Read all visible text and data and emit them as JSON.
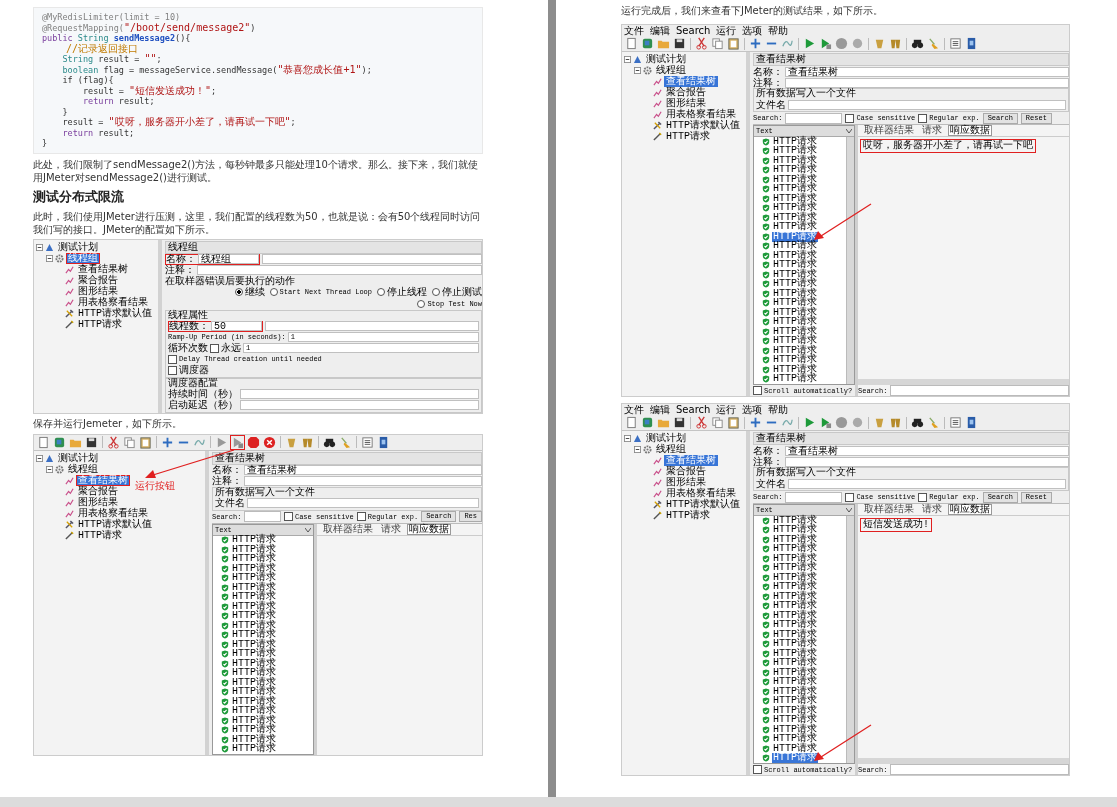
{
  "left_page": {
    "code_lines": [
      [
        {
          "text": "@MyRedisLimiter(limit = 10)",
          "kind": "annotation"
        }
      ],
      [
        {
          "text": "@RequestMapping(",
          "kind": "annotation"
        },
        {
          "text": "\"/boot/send/message2\"",
          "kind": "string"
        },
        {
          "text": ")",
          "kind": "plain"
        }
      ],
      [
        {
          "text": "public ",
          "kind": "keyword"
        },
        {
          "text": "String ",
          "kind": "type"
        },
        {
          "text": "sendMessage2",
          "kind": "method"
        },
        {
          "text": "(){",
          "kind": "plain"
        }
      ],
      [
        {
          "text": "    //记录返回接口",
          "kind": "comment"
        }
      ],
      [
        {
          "text": "    String",
          "kind": "type"
        },
        {
          "text": " result = ",
          "kind": "plain"
        },
        {
          "text": "\"\"",
          "kind": "string"
        },
        {
          "text": ";",
          "kind": "plain"
        }
      ],
      [
        {
          "text": "    boolean",
          "kind": "type"
        },
        {
          "text": " flag = messageService.sendMessage(",
          "kind": "plain"
        },
        {
          "text": "\"恭喜您成长值+1\"",
          "kind": "string"
        },
        {
          "text": ");",
          "kind": "plain"
        }
      ],
      [
        {
          "text": "    if (flag){",
          "kind": "plain"
        }
      ],
      [
        {
          "text": "        result = ",
          "kind": "plain"
        },
        {
          "text": "\"短信发送成功！\"",
          "kind": "string"
        },
        {
          "text": ";",
          "kind": "plain"
        }
      ],
      [
        {
          "text": "        return",
          "kind": "keyword"
        },
        {
          "text": " result;",
          "kind": "plain"
        }
      ],
      [
        {
          "text": "    }",
          "kind": "plain"
        }
      ],
      [
        {
          "text": "    result = ",
          "kind": "plain"
        },
        {
          "text": "\"哎呀，服务器开小差了，请再试一下吧\"",
          "kind": "string"
        },
        {
          "text": ";",
          "kind": "plain"
        }
      ],
      [
        {
          "text": "    return",
          "kind": "keyword"
        },
        {
          "text": " result;",
          "kind": "plain"
        }
      ],
      [
        {
          "text": "}",
          "kind": "plain"
        }
      ]
    ],
    "intro_text": "此处，我们限制了sendMessage2()方法，每秒钟最多只能处理10个请求。那么。接下来，我们就使用JMeter对sendMessage2()进行测试。",
    "heading": "测试分布式限流",
    "setup_text": "此时，我们使用JMeter进行压测，这里，我们配置的线程数为50，也就是说：会有50个线程同时访问我们写的接口。JMeter的配置如下所示。",
    "thread_group_screenshot": {
      "tree": [
        {
          "label": "测试计划",
          "kind": "plan",
          "selected": false,
          "marked": false,
          "children": [
            {
              "label": "线程组",
              "kind": "group",
              "selected": true,
              "marked": true,
              "children": [
                {
                  "label": "查看结果树",
                  "kind": "listener",
                  "selected": false,
                  "marked": false
                },
                {
                  "label": "聚合报告",
                  "kind": "listener",
                  "selected": false,
                  "marked": false
                },
                {
                  "label": "图形结果",
                  "kind": "listener",
                  "selected": false,
                  "marked": false
                },
                {
                  "label": "用表格察看结果",
                  "kind": "listener",
                  "selected": false,
                  "marked": false
                },
                {
                  "label": "HTTP请求默认值",
                  "kind": "config",
                  "selected": false,
                  "marked": false
                },
                {
                  "label": "HTTP请求",
                  "kind": "sampler",
                  "selected": false,
                  "marked": false
                }
              ]
            }
          ]
        }
      ],
      "panel": {
        "title": "线程组",
        "name_label": "名称：",
        "name": "线程组",
        "name_marked": true,
        "comment_label": "注释：",
        "error_action_label": "在取样器错误后要执行的动作",
        "error_actions": [
          {
            "label": "继续",
            "selected": true
          },
          {
            "label": "Start Next Thread Loop",
            "selected": false
          },
          {
            "label": "停止线程",
            "selected": false
          },
          {
            "label": "停止测试",
            "selected": false
          },
          {
            "label": "Stop Test Now",
            "selected": false
          }
        ],
        "properties_heading": "线程属性",
        "thread_count_label": "线程数：",
        "thread_count": "50",
        "thread_count_marked": true,
        "ramp_up_label": "Ramp-Up Period (in seconds):",
        "ramp_up": "1",
        "loop_label": "循环次数",
        "forever": {
          "label": "永远",
          "checked": false
        },
        "loops": "1",
        "delay_check": {
          "label": "Delay Thread creation until needed",
          "checked": false
        },
        "scheduler_check": {
          "label": "调度器",
          "checked": false
        },
        "scheduler_heading": "调度器配置",
        "duration_label": "持续时间（秒）",
        "startup_delay_label": "启动延迟（秒）"
      }
    },
    "run_caption": "保存并运行Jemeter，如下所示。",
    "run_screenshot": {
      "toolbar": {
        "running": true,
        "run_button_marked": true,
        "run_note": "运行按钮"
      },
      "tree": [
        {
          "label": "测试计划",
          "kind": "plan",
          "selected": false,
          "marked": false,
          "children": [
            {
              "label": "线程组",
              "kind": "group",
              "selected": false,
              "marked": false,
              "children": [
                {
                  "label": "查看结果树",
                  "kind": "listener",
                  "selected": true,
                  "marked": true
                },
                {
                  "label": "聚合报告",
                  "kind": "listener",
                  "selected": false,
                  "marked": false
                },
                {
                  "label": "图形结果",
                  "kind": "listener",
                  "selected": false,
                  "marked": false
                },
                {
                  "label": "用表格察看结果",
                  "kind": "listener",
                  "selected": false,
                  "marked": false
                },
                {
                  "label": "HTTP请求默认值",
                  "kind": "config",
                  "selected": false,
                  "marked": false
                },
                {
                  "label": "HTTP请求",
                  "kind": "sampler",
                  "selected": false,
                  "marked": false
                }
              ]
            }
          ]
        }
      ],
      "results": {
        "title": "查看结果树",
        "name_label": "名称：",
        "name": "查看结果树",
        "comment_label": "注释：",
        "file_heading": "所有数据写入一个文件",
        "file_label": "文件名",
        "search_label": "Search:",
        "checks": [
          {
            "label": "Case sensitive",
            "checked": false
          },
          {
            "label": "Regular exp.",
            "checked": false
          }
        ],
        "buttons": [
          "Search",
          "Res"
        ],
        "list_header": "Text",
        "rows": [
          {
            "label": "HTTP请求",
            "selected": false,
            "marked": false
          },
          {
            "label": "HTTP请求",
            "selected": false,
            "marked": false
          },
          {
            "label": "HTTP请求",
            "selected": false,
            "marked": false
          },
          {
            "label": "HTTP请求",
            "selected": false,
            "marked": false
          },
          {
            "label": "HTTP请求",
            "selected": false,
            "marked": false
          },
          {
            "label": "HTTP请求",
            "selected": false,
            "marked": false
          },
          {
            "label": "HTTP请求",
            "selected": false,
            "marked": false
          },
          {
            "label": "HTTP请求",
            "selected": false,
            "marked": false
          },
          {
            "label": "HTTP请求",
            "selected": false,
            "marked": false
          },
          {
            "label": "HTTP请求",
            "selected": false,
            "marked": false
          },
          {
            "label": "HTTP请求",
            "selected": false,
            "marked": false
          },
          {
            "label": "HTTP请求",
            "selected": false,
            "marked": false
          },
          {
            "label": "HTTP请求",
            "selected": false,
            "marked": false
          },
          {
            "label": "HTTP请求",
            "selected": false,
            "marked": false
          },
          {
            "label": "HTTP请求",
            "selected": false,
            "marked": false
          },
          {
            "label": "HTTP请求",
            "selected": false,
            "marked": false
          },
          {
            "label": "HTTP请求",
            "selected": false,
            "marked": false
          },
          {
            "label": "HTTP请求",
            "selected": false,
            "marked": false
          },
          {
            "label": "HTTP请求",
            "selected": false,
            "marked": false
          },
          {
            "label": "HTTP请求",
            "selected": false,
            "marked": false
          },
          {
            "label": "HTTP请求",
            "selected": false,
            "marked": false
          },
          {
            "label": "HTTP请求",
            "selected": false,
            "marked": false
          },
          {
            "label": "HTTP请求",
            "selected": false,
            "marked": false
          }
        ],
        "tabs": [
          {
            "label": "取样器结果",
            "selected": false
          },
          {
            "label": "请求",
            "selected": false
          },
          {
            "label": "响应数据",
            "selected": true
          }
        ]
      }
    }
  },
  "right_page": {
    "result_caption": "运行完成后，我们来查看下JMeter的测试结果，如下所示。",
    "failure_screenshot": {
      "menu": [
        "文件",
        "编辑",
        "Search",
        "运行",
        "选项",
        "帮助"
      ],
      "toolbar": {
        "running": false,
        "run_button_marked": false
      },
      "tree": [
        {
          "label": "测试计划",
          "kind": "plan",
          "selected": false,
          "marked": false,
          "children": [
            {
              "label": "线程组",
              "kind": "group",
              "selected": false,
              "marked": false,
              "children": [
                {
                  "label": "查看结果树",
                  "kind": "listener",
                  "selected": true,
                  "marked": false
                },
                {
                  "label": "聚合报告",
                  "kind": "listener",
                  "selected": false,
                  "marked": false
                },
                {
                  "label": "图形结果",
                  "kind": "listener",
                  "selected": false,
                  "marked": false
                },
                {
                  "label": "用表格察看结果",
                  "kind": "listener",
                  "selected": false,
                  "marked": false
                },
                {
                  "label": "HTTP请求默认值",
                  "kind": "config",
                  "selected": false,
                  "marked": false
                },
                {
                  "label": "HTTP请求",
                  "kind": "sampler",
                  "selected": false,
                  "marked": false
                }
              ]
            }
          ]
        }
      ],
      "results": {
        "title": "查看结果树",
        "name_label": "名称：",
        "name": "查看结果树",
        "comment_label": "注释：",
        "file_heading": "所有数据写入一个文件",
        "file_label": "文件名",
        "search_label": "Search:",
        "checks": [
          {
            "label": "Case sensitive",
            "checked": false
          },
          {
            "label": "Regular exp.",
            "checked": false
          }
        ],
        "buttons": [
          "Search",
          "Reset"
        ],
        "list_header": "Text",
        "rows": [
          {
            "label": "HTTP请求",
            "selected": false,
            "marked": false
          },
          {
            "label": "HTTP请求",
            "selected": false,
            "marked": false
          },
          {
            "label": "HTTP请求",
            "selected": false,
            "marked": false
          },
          {
            "label": "HTTP请求",
            "selected": false,
            "marked": false
          },
          {
            "label": "HTTP请求",
            "selected": false,
            "marked": false
          },
          {
            "label": "HTTP请求",
            "selected": false,
            "marked": false
          },
          {
            "label": "HTTP请求",
            "selected": false,
            "marked": false
          },
          {
            "label": "HTTP请求",
            "selected": false,
            "marked": false
          },
          {
            "label": "HTTP请求",
            "selected": false,
            "marked": false
          },
          {
            "label": "HTTP请求",
            "selected": false,
            "marked": false
          },
          {
            "label": "HTTP请求",
            "selected": true,
            "marked": true
          },
          {
            "label": "HTTP请求",
            "selected": false,
            "marked": false
          },
          {
            "label": "HTTP请求",
            "selected": false,
            "marked": false
          },
          {
            "label": "HTTP请求",
            "selected": false,
            "marked": false
          },
          {
            "label": "HTTP请求",
            "selected": false,
            "marked": false
          },
          {
            "label": "HTTP请求",
            "selected": false,
            "marked": false
          },
          {
            "label": "HTTP请求",
            "selected": false,
            "marked": false
          },
          {
            "label": "HTTP请求",
            "selected": false,
            "marked": false
          },
          {
            "label": "HTTP请求",
            "selected": false,
            "marked": false
          },
          {
            "label": "HTTP请求",
            "selected": false,
            "marked": false
          },
          {
            "label": "HTTP请求",
            "selected": false,
            "marked": false
          },
          {
            "label": "HTTP请求",
            "selected": false,
            "marked": false
          },
          {
            "label": "HTTP请求",
            "selected": false,
            "marked": false
          },
          {
            "label": "HTTP请求",
            "selected": false,
            "marked": false
          },
          {
            "label": "HTTP请求",
            "selected": false,
            "marked": false
          },
          {
            "label": "HTTP请求",
            "selected": false,
            "marked": false
          }
        ],
        "tabs": [
          {
            "label": "取样器结果",
            "selected": false
          },
          {
            "label": "请求",
            "selected": false
          },
          {
            "label": "响应数据",
            "selected": true
          }
        ],
        "response": "哎呀，服务器开小差了，请再试一下吧",
        "response_marked": true,
        "scroll_check": {
          "label": "Scroll automatically?",
          "checked": false
        },
        "bottom_search_label": "Search:"
      }
    },
    "success_screenshot": {
      "menu": [
        "文件",
        "编辑",
        "Search",
        "运行",
        "选项",
        "帮助"
      ],
      "toolbar": {
        "running": false,
        "run_button_marked": false
      },
      "tree": [
        {
          "label": "测试计划",
          "kind": "plan",
          "selected": false,
          "marked": false,
          "children": [
            {
              "label": "线程组",
              "kind": "group",
              "selected": false,
              "marked": false,
              "children": [
                {
                  "label": "查看结果树",
                  "kind": "listener",
                  "selected": true,
                  "marked": false
                },
                {
                  "label": "聚合报告",
                  "kind": "listener",
                  "selected": false,
                  "marked": false
                },
                {
                  "label": "图形结果",
                  "kind": "listener",
                  "selected": false,
                  "marked": false
                },
                {
                  "label": "用表格察看结果",
                  "kind": "listener",
                  "selected": false,
                  "marked": false
                },
                {
                  "label": "HTTP请求默认值",
                  "kind": "config",
                  "selected": false,
                  "marked": false
                },
                {
                  "label": "HTTP请求",
                  "kind": "sampler",
                  "selected": false,
                  "marked": false
                }
              ]
            }
          ]
        }
      ],
      "results": {
        "title": "查看结果树",
        "name_label": "名称：",
        "name": "查看结果树",
        "comment_label": "注释：",
        "file_heading": "所有数据写入一个文件",
        "file_label": "文件名",
        "search_label": "Search:",
        "checks": [
          {
            "label": "Case sensitive",
            "checked": false
          },
          {
            "label": "Regular exp.",
            "checked": false
          }
        ],
        "buttons": [
          "Search",
          "Reset"
        ],
        "list_header": "Text",
        "rows": [
          {
            "label": "HTTP请求",
            "selected": false,
            "marked": false
          },
          {
            "label": "HTTP请求",
            "selected": false,
            "marked": false
          },
          {
            "label": "HTTP请求",
            "selected": false,
            "marked": false
          },
          {
            "label": "HTTP请求",
            "selected": false,
            "marked": false
          },
          {
            "label": "HTTP请求",
            "selected": false,
            "marked": false
          },
          {
            "label": "HTTP请求",
            "selected": false,
            "marked": false
          },
          {
            "label": "HTTP请求",
            "selected": false,
            "marked": false
          },
          {
            "label": "HTTP请求",
            "selected": false,
            "marked": false
          },
          {
            "label": "HTTP请求",
            "selected": false,
            "marked": false
          },
          {
            "label": "HTTP请求",
            "selected": false,
            "marked": false
          },
          {
            "label": "HTTP请求",
            "selected": false,
            "marked": false
          },
          {
            "label": "HTTP请求",
            "selected": false,
            "marked": false
          },
          {
            "label": "HTTP请求",
            "selected": false,
            "marked": false
          },
          {
            "label": "HTTP请求",
            "selected": false,
            "marked": false
          },
          {
            "label": "HTTP请求",
            "selected": false,
            "marked": false
          },
          {
            "label": "HTTP请求",
            "selected": false,
            "marked": false
          },
          {
            "label": "HTTP请求",
            "selected": false,
            "marked": false
          },
          {
            "label": "HTTP请求",
            "selected": false,
            "marked": false
          },
          {
            "label": "HTTP请求",
            "selected": false,
            "marked": false
          },
          {
            "label": "HTTP请求",
            "selected": false,
            "marked": false
          },
          {
            "label": "HTTP请求",
            "selected": false,
            "marked": false
          },
          {
            "label": "HTTP请求",
            "selected": false,
            "marked": false
          },
          {
            "label": "HTTP请求",
            "selected": false,
            "marked": false
          },
          {
            "label": "HTTP请求",
            "selected": false,
            "marked": false
          },
          {
            "label": "HTTP请求",
            "selected": false,
            "marked": false
          },
          {
            "label": "HTTP请求",
            "selected": true,
            "marked": true
          }
        ],
        "tabs": [
          {
            "label": "取样器结果",
            "selected": false
          },
          {
            "label": "请求",
            "selected": false
          },
          {
            "label": "响应数据",
            "selected": true
          }
        ],
        "response": "短信发送成功!",
        "response_marked": true,
        "scroll_check": {
          "label": "Scroll automatically?",
          "checked": false
        },
        "bottom_search_label": "Search:"
      }
    }
  }
}
